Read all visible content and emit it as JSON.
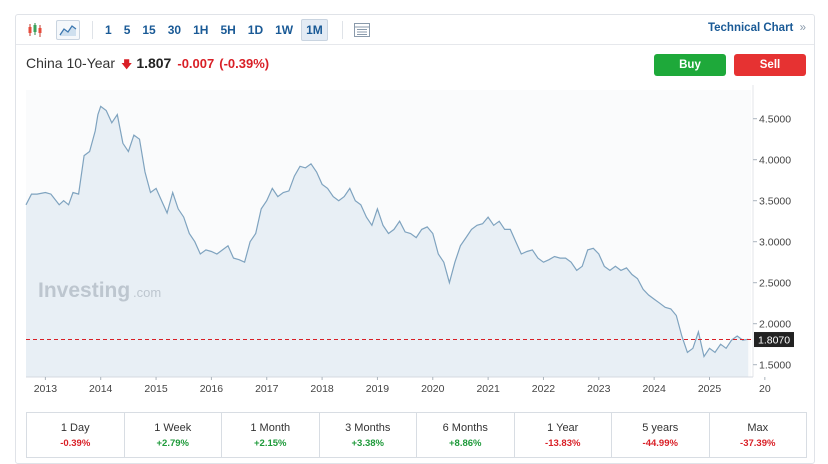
{
  "toolbar": {
    "intervals": [
      "1",
      "5",
      "15",
      "30",
      "1H",
      "5H",
      "1D",
      "1W",
      "1M"
    ],
    "active_interval": "1M",
    "technical_chart_label": "Technical Chart",
    "technical_chart_arrow": "»"
  },
  "header": {
    "name": "China 10-Year",
    "price": "1.807",
    "change": "-0.007",
    "change_pct": "(-0.39%)"
  },
  "buttons": {
    "buy": "Buy",
    "sell": "Sell"
  },
  "watermark": {
    "brand": "Investing",
    "suffix": ".com"
  },
  "colors": {
    "line": "#7fa3bf",
    "area": "#e8eff5",
    "down": "#d91f26",
    "up": "#1e9a3a",
    "buy": "#1ea93a",
    "sell": "#e63232",
    "link": "#1a5a96"
  },
  "chart_data": {
    "type": "area",
    "x_ticks": [
      "2013",
      "2014",
      "2015",
      "2016",
      "2017",
      "2018",
      "2019",
      "2020",
      "2021",
      "2022",
      "2023",
      "2024",
      "2025",
      "20"
    ],
    "y_ticks": [
      "1.5000",
      "2.0000",
      "2.5000",
      "3.0000",
      "3.5000",
      "4.0000",
      "4.5000"
    ],
    "ylim": [
      1.35,
      4.85
    ],
    "xlim": [
      2012.65,
      2025.75
    ],
    "current_value_label": "1.8070",
    "current_value": 1.807,
    "series": [
      {
        "x": [
          2012.65,
          2012.75,
          2012.85,
          2013.0,
          2013.1,
          2013.25,
          2013.33,
          2013.42,
          2013.5,
          2013.6,
          2013.7,
          2013.8,
          2013.9,
          2013.95,
          2014.0,
          2014.1,
          2014.2,
          2014.3,
          2014.4,
          2014.5,
          2014.6,
          2014.7,
          2014.8,
          2014.9,
          2015.0,
          2015.1,
          2015.2,
          2015.3,
          2015.4,
          2015.5,
          2015.6,
          2015.7,
          2015.8,
          2015.9,
          2016.0,
          2016.1,
          2016.2,
          2016.3,
          2016.4,
          2016.5,
          2016.6,
          2016.7,
          2016.8,
          2016.9,
          2017.0,
          2017.1,
          2017.2,
          2017.3,
          2017.4,
          2017.5,
          2017.6,
          2017.7,
          2017.8,
          2017.9,
          2018.0,
          2018.1,
          2018.2,
          2018.3,
          2018.4,
          2018.5,
          2018.6,
          2018.7,
          2018.8,
          2018.9,
          2019.0,
          2019.1,
          2019.2,
          2019.3,
          2019.4,
          2019.5,
          2019.6,
          2019.7,
          2019.8,
          2019.9,
          2020.0,
          2020.1,
          2020.2,
          2020.3,
          2020.4,
          2020.5,
          2020.6,
          2020.7,
          2020.8,
          2020.9,
          2021.0,
          2021.1,
          2021.2,
          2021.3,
          2021.4,
          2021.5,
          2021.6,
          2021.7,
          2021.8,
          2021.9,
          2022.0,
          2022.1,
          2022.2,
          2022.3,
          2022.4,
          2022.5,
          2022.6,
          2022.7,
          2022.8,
          2022.9,
          2023.0,
          2023.1,
          2023.2,
          2023.3,
          2023.4,
          2023.5,
          2023.6,
          2023.7,
          2023.8,
          2023.9,
          2024.0,
          2024.1,
          2024.2,
          2024.3,
          2024.4,
          2024.5,
          2024.6,
          2024.7,
          2024.8,
          2024.9,
          2025.0,
          2025.1,
          2025.2,
          2025.3,
          2025.4,
          2025.5,
          2025.6,
          2025.7
        ],
        "y": [
          3.45,
          3.58,
          3.58,
          3.6,
          3.58,
          3.45,
          3.5,
          3.45,
          3.6,
          3.58,
          4.05,
          4.1,
          4.35,
          4.55,
          4.65,
          4.6,
          4.45,
          4.55,
          4.2,
          4.1,
          4.3,
          4.25,
          3.85,
          3.6,
          3.65,
          3.5,
          3.35,
          3.6,
          3.4,
          3.3,
          3.1,
          3.0,
          2.85,
          2.9,
          2.88,
          2.85,
          2.9,
          2.95,
          2.8,
          2.78,
          2.75,
          3.0,
          3.1,
          3.4,
          3.5,
          3.65,
          3.55,
          3.6,
          3.62,
          3.8,
          3.92,
          3.9,
          3.95,
          3.85,
          3.7,
          3.65,
          3.55,
          3.5,
          3.55,
          3.65,
          3.5,
          3.45,
          3.3,
          3.2,
          3.4,
          3.2,
          3.1,
          3.15,
          3.25,
          3.12,
          3.1,
          3.05,
          3.15,
          3.18,
          3.1,
          2.85,
          2.75,
          2.5,
          2.75,
          2.95,
          3.05,
          3.15,
          3.2,
          3.22,
          3.3,
          3.2,
          3.25,
          3.15,
          3.15,
          3.0,
          2.85,
          2.88,
          2.9,
          2.8,
          2.75,
          2.78,
          2.82,
          2.8,
          2.8,
          2.75,
          2.65,
          2.7,
          2.9,
          2.92,
          2.85,
          2.7,
          2.65,
          2.7,
          2.65,
          2.68,
          2.6,
          2.55,
          2.42,
          2.35,
          2.3,
          2.25,
          2.2,
          2.18,
          2.1,
          1.85,
          1.65,
          1.7,
          1.9,
          1.6,
          1.7,
          1.65,
          1.75,
          1.7,
          1.8,
          1.85,
          1.8,
          1.81
        ]
      }
    ]
  },
  "performance": [
    {
      "label": "1 Day",
      "value": "-0.39%",
      "dir": "neg"
    },
    {
      "label": "1 Week",
      "value": "+2.79%",
      "dir": "pos"
    },
    {
      "label": "1 Month",
      "value": "+2.15%",
      "dir": "pos"
    },
    {
      "label": "3 Months",
      "value": "+3.38%",
      "dir": "pos"
    },
    {
      "label": "6 Months",
      "value": "+8.86%",
      "dir": "pos"
    },
    {
      "label": "1 Year",
      "value": "-13.83%",
      "dir": "neg"
    },
    {
      "label": "5 years",
      "value": "-44.99%",
      "dir": "neg"
    },
    {
      "label": "Max",
      "value": "-37.39%",
      "dir": "neg"
    }
  ]
}
